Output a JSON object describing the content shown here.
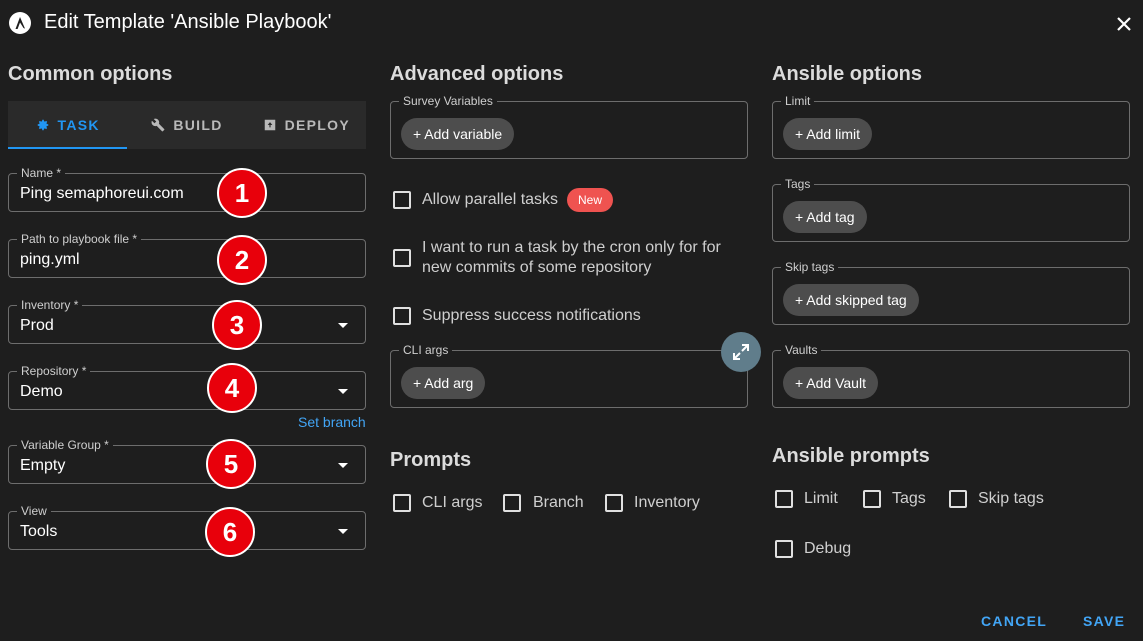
{
  "dialog": {
    "title": "Edit Template 'Ansible Playbook'"
  },
  "icons": {
    "logo": "ansible-logo-icon",
    "close": "close-icon",
    "task": "gear-icon",
    "build": "wrench-icon",
    "deploy": "deploy-icon",
    "expand": "expand-arrows-icon",
    "dropdown": "chevron-down-icon"
  },
  "colors": {
    "background": "#1e1e1e",
    "accent": "#2196f3",
    "marker": "#e8000b",
    "badge": "#ef5350"
  },
  "common": {
    "title": "Common options",
    "tabs": [
      {
        "label": "TASK",
        "active": true
      },
      {
        "label": "BUILD",
        "active": false
      },
      {
        "label": "DEPLOY",
        "active": false
      }
    ],
    "fields": {
      "name": {
        "label": "Name *",
        "value": "Ping semaphoreui.com",
        "marker": "1"
      },
      "playbook": {
        "label": "Path to playbook file *",
        "value": "ping.yml",
        "marker": "2"
      },
      "inventory": {
        "label": "Inventory *",
        "value": "Prod",
        "marker": "3"
      },
      "repository": {
        "label": "Repository *",
        "value": "Demo",
        "marker": "4"
      },
      "variable_group": {
        "label": "Variable Group *",
        "value": "Empty",
        "marker": "5"
      },
      "view": {
        "label": "View",
        "value": "Tools",
        "marker": "6"
      }
    },
    "set_branch": "Set branch"
  },
  "advanced": {
    "title": "Advanced options",
    "survey": {
      "label": "Survey Variables",
      "button": "+ Add variable"
    },
    "allow_parallel": {
      "label": "Allow parallel tasks",
      "badge": "New"
    },
    "cron_commits": {
      "label": "I want to run a task by the cron only for for new commits of some repository"
    },
    "suppress": {
      "label": "Suppress success notifications"
    },
    "cli_args": {
      "label": "CLI args",
      "button": "+ Add arg"
    }
  },
  "prompts": {
    "title": "Prompts",
    "items": [
      "CLI args",
      "Branch",
      "Inventory"
    ]
  },
  "ansible": {
    "title": "Ansible options",
    "limit": {
      "label": "Limit",
      "button": "+ Add limit"
    },
    "tags": {
      "label": "Tags",
      "button": "+ Add tag"
    },
    "skip_tags": {
      "label": "Skip tags",
      "button": "+ Add skipped tag"
    },
    "vaults": {
      "label": "Vaults",
      "button": "+ Add Vault"
    }
  },
  "ansible_prompts": {
    "title": "Ansible prompts",
    "items": [
      "Limit",
      "Tags",
      "Skip tags",
      "Debug"
    ]
  },
  "actions": {
    "cancel": "CANCEL",
    "save": "SAVE"
  }
}
